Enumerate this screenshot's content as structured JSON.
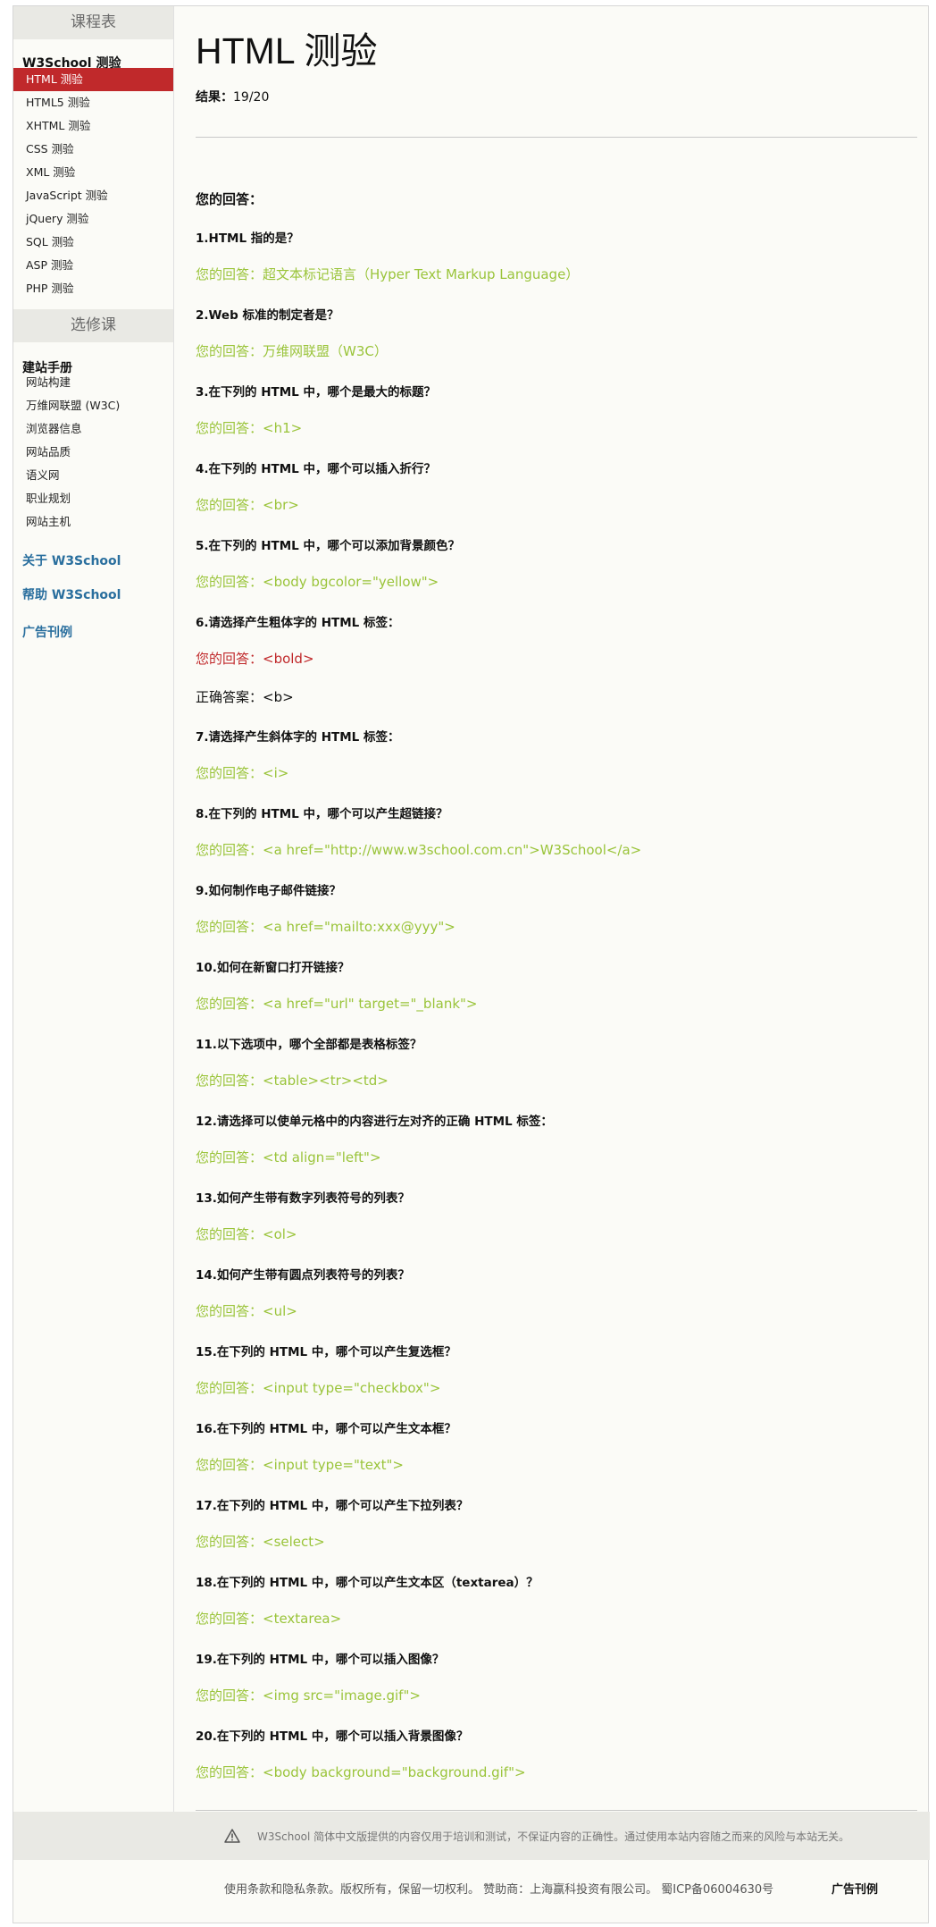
{
  "sidebar": {
    "head1": "课程表",
    "group1": "W3School 测验",
    "items1": [
      "HTML 测验",
      "HTML5 测验",
      "XHTML 测验",
      "CSS 测验",
      "XML 测验",
      "JavaScript 测验",
      "jQuery 测验",
      "SQL 测验",
      "ASP 测验",
      "PHP 测验"
    ],
    "head2": "选修课",
    "group2": "建站手册",
    "items2": [
      "网站构建",
      "万维网联盟 (W3C)",
      "浏览器信息",
      "网站品质",
      "语义网",
      "职业规划",
      "网站主机"
    ],
    "link_about": "关于 W3School",
    "link_help": "帮助 W3School",
    "link_ads": "广告刊例"
  },
  "main": {
    "title": "HTML 测验",
    "result_label": "结果：",
    "result_value": "19/20",
    "answers_title": "您的回答：",
    "questions": [
      {
        "q": "1.HTML 指的是？",
        "a": "您的回答：超文本标记语言（Hyper Text Markup Language）"
      },
      {
        "q": "2.Web 标准的制定者是？",
        "a": "您的回答：万维网联盟（W3C）"
      },
      {
        "q": "3.在下列的 HTML 中，哪个是最大的标题？",
        "a": "您的回答：<h1>"
      },
      {
        "q": "4.在下列的 HTML 中，哪个可以插入折行？",
        "a": "您的回答：<br>"
      },
      {
        "q": "5.在下列的 HTML 中，哪个可以添加背景颜色？",
        "a": "您的回答：<body bgcolor=\"yellow\">"
      },
      {
        "q": "6.请选择产生粗体字的 HTML 标签：",
        "a": "您的回答：<bold>",
        "correct": "正确答案：<b>"
      },
      {
        "q": "7.请选择产生斜体字的 HTML 标签：",
        "a": "您的回答：<i>"
      },
      {
        "q": "8.在下列的 HTML 中，哪个可以产生超链接？",
        "a": "您的回答：<a href=\"http://www.w3school.com.cn\">W3School</a>"
      },
      {
        "q": "9.如何制作电子邮件链接？",
        "a": "您的回答：<a href=\"mailto:xxx@yyy\">"
      },
      {
        "q": "10.如何在新窗口打开链接？",
        "a": "您的回答：<a href=\"url\" target=\"_blank\">"
      },
      {
        "q": "11.以下选项中，哪个全部都是表格标签？",
        "a": "您的回答：<table><tr><td>"
      },
      {
        "q": "12.请选择可以使单元格中的内容进行左对齐的正确 HTML 标签：",
        "a": "您的回答：<td align=\"left\">"
      },
      {
        "q": "13.如何产生带有数字列表符号的列表？",
        "a": "您的回答：<ol>"
      },
      {
        "q": "14.如何产生带有圆点列表符号的列表？",
        "a": "您的回答：<ul>"
      },
      {
        "q": "15.在下列的 HTML 中，哪个可以产生复选框？",
        "a": "您的回答：<input type=\"checkbox\">"
      },
      {
        "q": "16.在下列的 HTML 中，哪个可以产生文本框？",
        "a": "您的回答：<input type=\"text\">"
      },
      {
        "q": "17.在下列的 HTML 中，哪个可以产生下拉列表？",
        "a": "您的回答：<select>"
      },
      {
        "q": "18.在下列的 HTML 中，哪个可以产生文本区（textarea）？",
        "a": "您的回答：<textarea>"
      },
      {
        "q": "19.在下列的 HTML 中，哪个可以插入图像？",
        "a": "您的回答：<img src=\"image.gif\">"
      },
      {
        "q": "20.在下列的 HTML 中，哪个可以插入背景图像？",
        "a": "您的回答：<body background=\"background.gif\">"
      }
    ]
  },
  "footer": {
    "disclaimer": "W3School 简体中文版提供的内容仅用于培训和测试，不保证内容的正确性。通过使用本站内容随之而来的风险与本站无关。",
    "line": "使用条款和隐私条款。版权所有，保留一切权利。 赞助商：上海赢科投资有限公司。 蜀ICP备06004630号",
    "ads": "广告刊例"
  },
  "colors": {
    "correct": "#9ac43a",
    "wrong": "#c0292b",
    "active": "#c0292b",
    "link": "#2a6f9e"
  },
  "icons": [
    "warning-icon"
  ]
}
